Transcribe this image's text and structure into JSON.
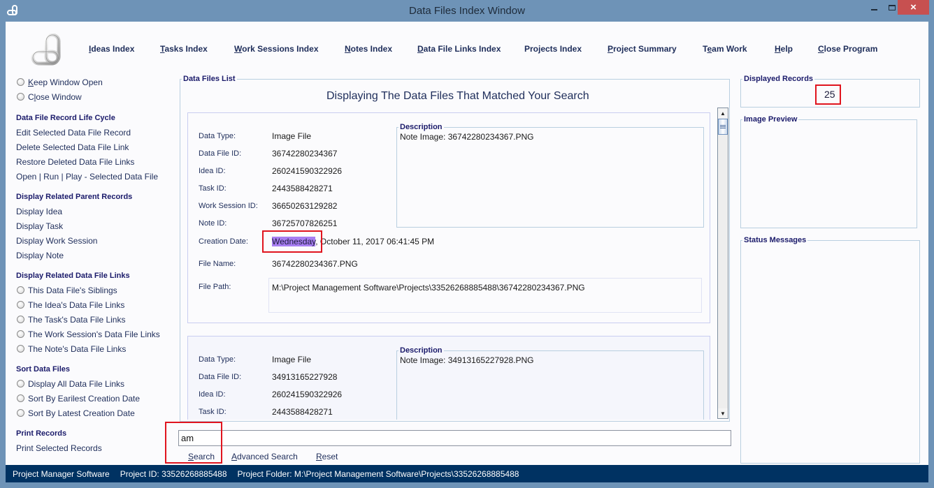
{
  "window": {
    "title": "Data Files Index Window",
    "controls": {
      "minimize": "minimize",
      "maximize": "maximize",
      "close": "×"
    }
  },
  "nav": [
    {
      "label_ul": "I",
      "label_rest": "deas Index"
    },
    {
      "label_ul": "T",
      "label_rest": "asks Index"
    },
    {
      "label_ul": "W",
      "label_rest": "ork Sessions Index"
    },
    {
      "label_ul": "N",
      "label_rest": "otes Index"
    },
    {
      "label_ul": "D",
      "label_rest": "ata File Links Index"
    },
    {
      "label_ul": "",
      "label_rest": "Projects Index"
    },
    {
      "label_ul": "P",
      "label_rest": "roject Summary"
    },
    {
      "label_pre": "T",
      "label_ul": "e",
      "label_rest": "am Work"
    },
    {
      "label_ul": "H",
      "label_rest": "elp"
    },
    {
      "label_ul": "C",
      "label_rest": "lose Program"
    }
  ],
  "sidebar": {
    "window_options": [
      {
        "pre": "",
        "ul": "K",
        "rest": "eep Window Open"
      },
      {
        "pre": "C",
        "ul": "l",
        "rest": "ose Window"
      }
    ],
    "lifecycle": {
      "heading": "Data File Record Life Cycle",
      "items": [
        "Edit Selected Data File Record",
        "Delete Selected Data File Link",
        "Restore Deleted Data File Links",
        "Open | Run | Play - Selected Data File"
      ]
    },
    "parents": {
      "heading": "Display Related Parent Records",
      "items": [
        "Display Idea",
        "Display Task",
        "Display Work Session",
        "Display Note"
      ]
    },
    "links": {
      "heading": "Display Related Data File Links",
      "items": [
        "This Data File's Siblings",
        "The Idea's Data File Links",
        "The Task's Data File Links",
        "The Work Session's Data File Links",
        "The Note's Data File Links"
      ]
    },
    "sort": {
      "heading": "Sort Data Files",
      "items": [
        "Display All Data File Links",
        "Sort By Earilest Creation Date",
        "Sort By Latest Creation Date"
      ]
    },
    "print": {
      "heading": "Print Records",
      "items": [
        "Print Selected Records"
      ]
    }
  },
  "files_list": {
    "legend": "Data Files List",
    "heading": "Displaying The Data Files That Matched Your Search",
    "labels": {
      "data_type": "Data Type:",
      "data_file_id": "Data File ID:",
      "idea_id": "Idea ID:",
      "task_id": "Task ID:",
      "work_session_id": "Work Session ID:",
      "note_id": "Note ID:",
      "creation_date": "Creation Date:",
      "file_name": "File Name:",
      "file_path": "File Path:",
      "description": "Description"
    },
    "records": [
      {
        "data_type": "Image File",
        "data_file_id": "36742280234367",
        "idea_id": "260241590322926",
        "task_id": "2443588428271",
        "work_session_id": "36650263129282",
        "note_id": "36725707826251",
        "creation_day": "Wednesday",
        "creation_rest": ", October 11, 2017   06:41:45 PM",
        "file_name": "36742280234367.PNG",
        "file_path": "M:\\Project Management Software\\Projects\\33526268885488\\36742280234367.PNG",
        "description": "Note Image: 36742280234367.PNG"
      },
      {
        "data_type": "Image File",
        "data_file_id": "34913165227928",
        "idea_id": "260241590322926",
        "task_id": "2443588428271",
        "description": "Note Image: 34913165227928.PNG"
      }
    ]
  },
  "search": {
    "value": "am",
    "buttons": [
      {
        "ul": "S",
        "rest": "earch"
      },
      {
        "ul": "A",
        "rest": "dvanced Search"
      },
      {
        "ul": "R",
        "rest": "eset"
      }
    ]
  },
  "right_panel": {
    "displayed_records_legend": "Displayed Records",
    "displayed_records_count": "25",
    "image_preview_legend": "Image Preview",
    "status_messages_legend": "Status Messages"
  },
  "statusbar": {
    "app_name": "Project Manager Software",
    "project_id": "Project ID:  33526268885488",
    "project_folder": "Project Folder: M:\\Project Management Software\\Projects\\33526268885488"
  },
  "colors": {
    "frame": "#6e93b7",
    "statusbar": "#003262",
    "close_button": "#c75050",
    "highlight": "#a77ef2",
    "annotation_red": "#e0141e",
    "nav_text": "#1e2d5a"
  }
}
